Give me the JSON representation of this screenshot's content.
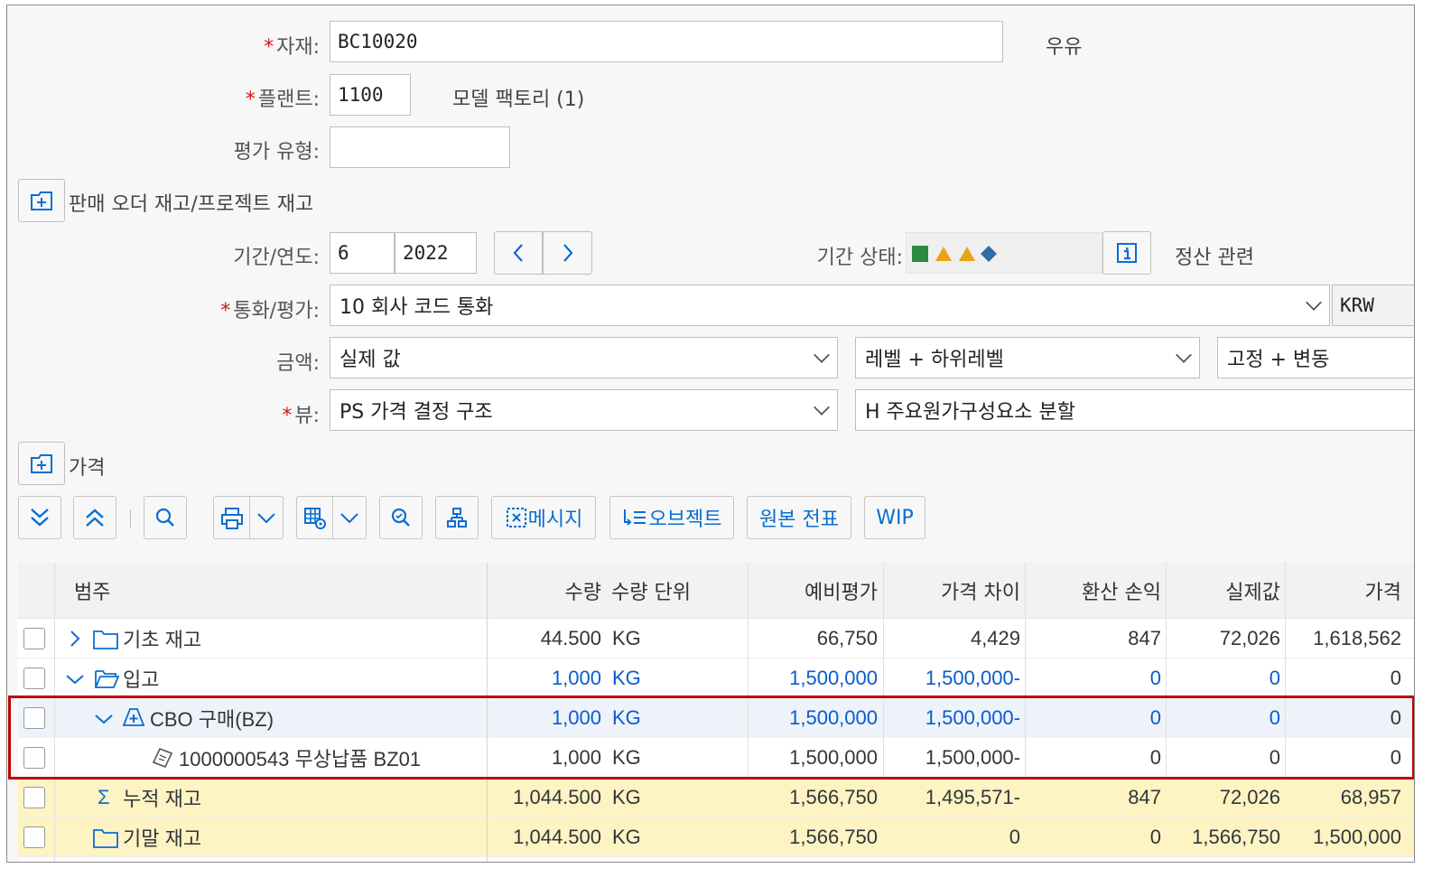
{
  "form": {
    "material_label": "자재:",
    "material_value": "BC10020",
    "material_desc": "우유",
    "plant_label": "플랜트:",
    "plant_value": "1100",
    "plant_desc": "모델 팩토리 (1)",
    "valuation_type_label": "평가 유형:",
    "valuation_type_value": "",
    "sales_order_stock_label": "판매 오더 재고/프로젝트 재고",
    "period_year_label": "기간/연도:",
    "period_value": "6",
    "year_value": "2022",
    "period_status_label": "기간 상태:",
    "settlement_label": "정산 관련",
    "currency_label": "통화/평가:",
    "currency_value": "10 회사 코드 통화",
    "currency_code": "KRW",
    "amount_label": "금액:",
    "amount_value": "실제 값",
    "level_value": "레벨 + 하위레벨",
    "fixed_variable_value": "고정 + 변동",
    "view_label": "뷰:",
    "view_value": "PS 가격 결정 구조",
    "cost_component_value": "H 주요원가구성요소 분할",
    "price_section_label": "가격"
  },
  "status_colors": {
    "green": "#2b8a3e",
    "orange": "#e8a317",
    "blue": "#2f6da8"
  },
  "toolbar": {
    "message_label": "메시지",
    "object_label": "오브젝트",
    "original_doc_label": "원본 전표",
    "wip_label": "WIP"
  },
  "table": {
    "headers": [
      "범주",
      "수량",
      "수량 단위",
      "예비평가",
      "가격 차이",
      "환산 손익",
      "실제값",
      "가격"
    ],
    "rows": [
      {
        "category": "기초 재고",
        "qty": "44.500",
        "unit": "KG",
        "prelim": "66,750",
        "price_diff": "4,429",
        "exch": "847",
        "actual": "72,026",
        "price": "1,618,562"
      },
      {
        "category": "입고",
        "qty": "1,000",
        "unit": "KG",
        "prelim": "1,500,000",
        "price_diff": "1,500,000-",
        "exch": "0",
        "actual": "0",
        "price": "0"
      },
      {
        "category": "CBO 구매(BZ)",
        "qty": "1,000",
        "unit": "KG",
        "prelim": "1,500,000",
        "price_diff": "1,500,000-",
        "exch": "0",
        "actual": "0",
        "price": "0"
      },
      {
        "category": "1000000543 무상납품 BZ01",
        "qty": "1,000",
        "unit": "KG",
        "prelim": "1,500,000",
        "price_diff": "1,500,000-",
        "exch": "0",
        "actual": "0",
        "price": "0"
      },
      {
        "category": "누적 재고",
        "qty": "1,044.500",
        "unit": "KG",
        "prelim": "1,566,750",
        "price_diff": "1,495,571-",
        "exch": "847",
        "actual": "72,026",
        "price": "68,957"
      },
      {
        "category": "기말 재고",
        "qty": "1,044.500",
        "unit": "KG",
        "prelim": "1,566,750",
        "price_diff": "0",
        "exch": "0",
        "actual": "1,566,750",
        "price": "1,500,000"
      }
    ]
  }
}
